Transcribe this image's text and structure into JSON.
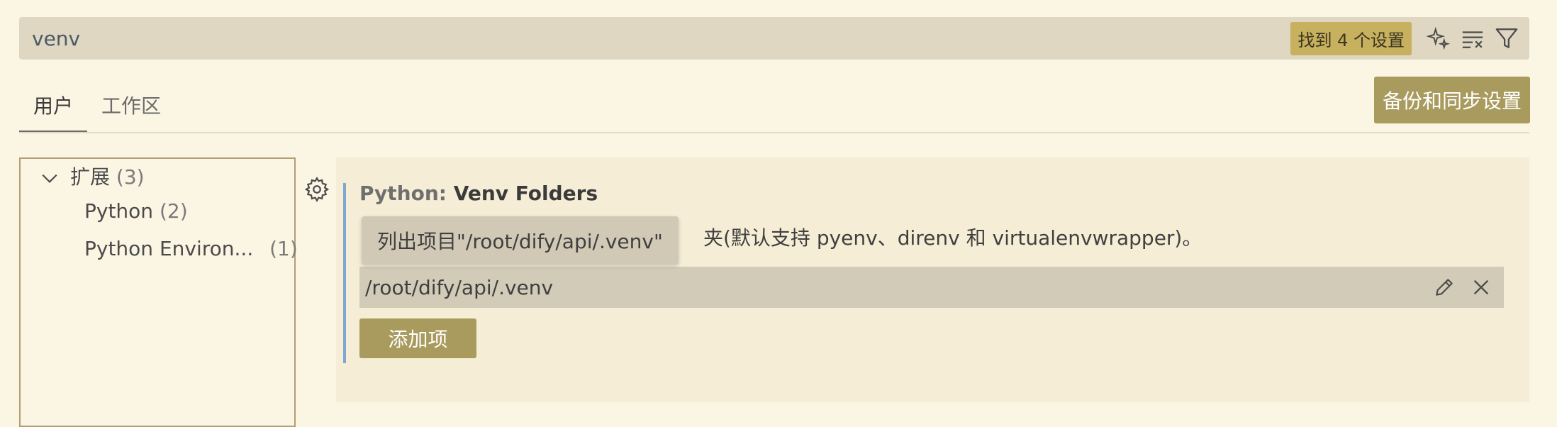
{
  "search": {
    "value": "venv",
    "result_count_label": "找到 4 个设置",
    "icons": [
      "sparkle-icon",
      "clear-filter-icon",
      "filter-icon"
    ]
  },
  "tabs": [
    {
      "label": "用户",
      "active": true
    },
    {
      "label": "工作区",
      "active": false
    }
  ],
  "sync_button_label": "备份和同步设置",
  "toc": {
    "group": {
      "label": "扩展",
      "count": "(3)",
      "expanded": true
    },
    "items": [
      {
        "label": "Python",
        "count": "(2)"
      },
      {
        "label": "Python Environ...",
        "count": "(1)"
      }
    ]
  },
  "setting": {
    "category": "Python: ",
    "name": "Venv Folders",
    "description_visible": "夹(默认支持 pyenv、direnv 和 virtualenvwrapper)。",
    "tooltip": "列出项目\"/root/dify/api/.venv\"",
    "list_items": [
      "/root/dify/api/.venv"
    ],
    "add_button_label": "添加项"
  },
  "colors": {
    "background": "#FBF5E3",
    "accent_button": "#A99A5D",
    "badge": "#C7B15E",
    "focus_bar": "#7FA7D4"
  }
}
